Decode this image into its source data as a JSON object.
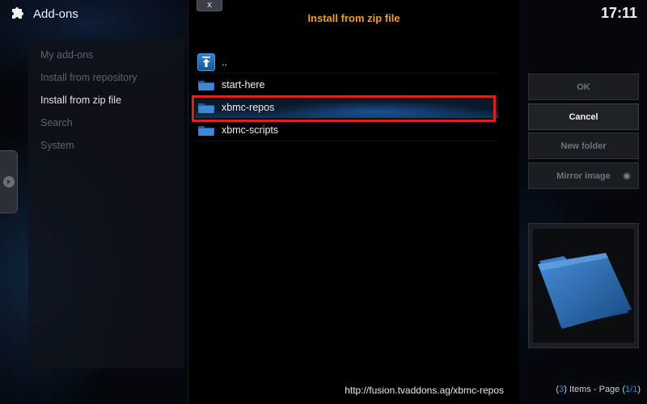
{
  "header": {
    "title": "Add-ons",
    "clock": "17:11"
  },
  "menu": {
    "items": [
      {
        "label": "My add-ons",
        "active": false
      },
      {
        "label": "Install from repository",
        "active": false
      },
      {
        "label": "Install from zip file",
        "active": true
      },
      {
        "label": "Search",
        "active": false
      },
      {
        "label": "System",
        "active": false
      }
    ]
  },
  "dialog": {
    "title": "Install from zip file",
    "close_label": "x",
    "files": [
      {
        "name": "..",
        "icon": "parent-folder-icon"
      },
      {
        "name": "start-here",
        "icon": "folder-icon"
      },
      {
        "name": "xbmc-repos",
        "icon": "folder-icon",
        "selected": true
      },
      {
        "name": "xbmc-scripts",
        "icon": "folder-icon"
      }
    ],
    "path": "http://fusion.tvaddons.ag/xbmc-repos"
  },
  "buttons": {
    "ok": "OK",
    "cancel": "Cancel",
    "new_folder": "New folder",
    "mirror_image": "Mirror image"
  },
  "footer": {
    "items_count": "3",
    "items_label": "Items - Page",
    "page": "1/1"
  },
  "colors": {
    "title_accent": "#eb9e2c",
    "highlight_border": "#e0201a",
    "count_accent": "#2e8ddf",
    "folder_blue": "#1f5fa8"
  }
}
